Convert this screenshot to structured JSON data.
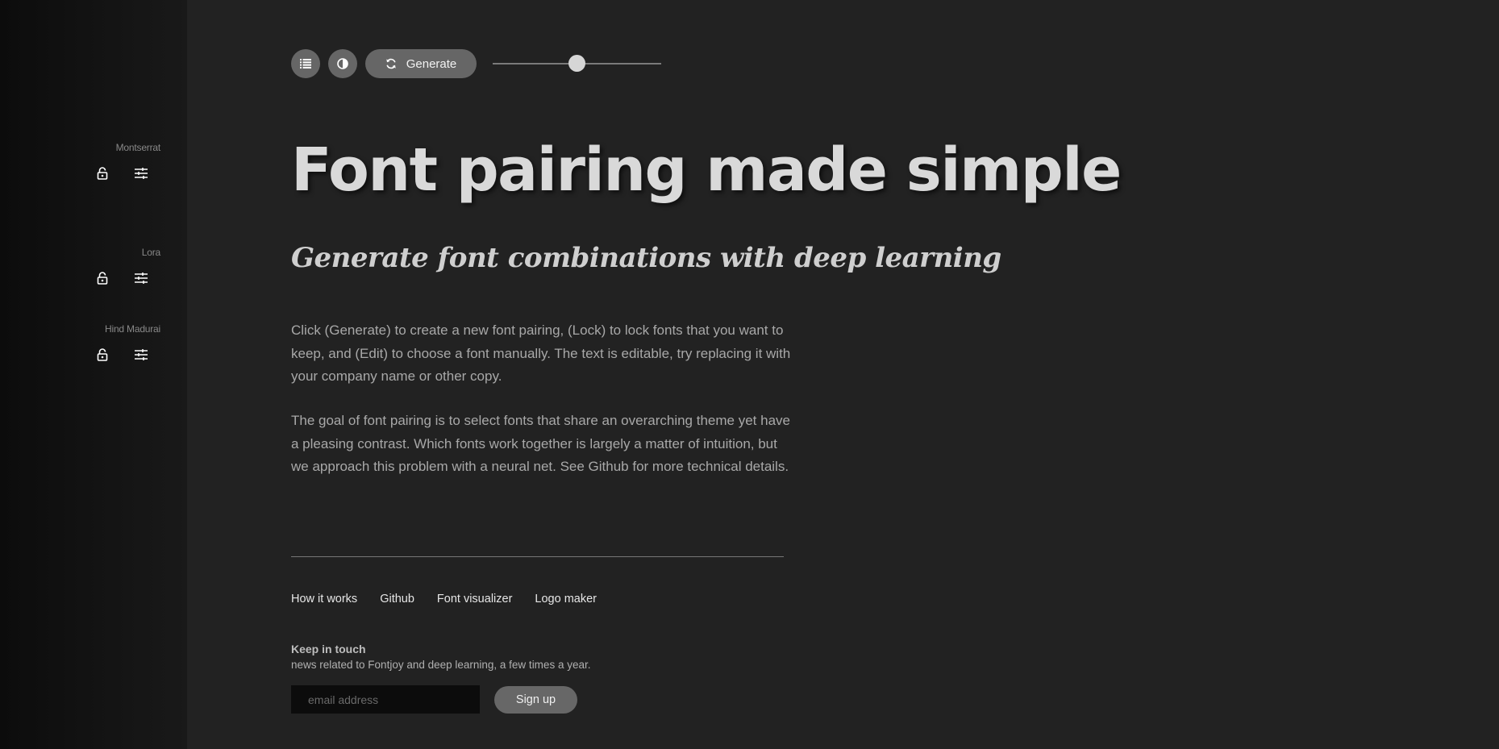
{
  "sidebar": {
    "fonts": [
      {
        "name": "Montserrat"
      },
      {
        "name": "Lora"
      },
      {
        "name": "Hind Madurai"
      }
    ]
  },
  "toolbar": {
    "generate_label": "Generate",
    "weight_slider_fraction": 0.5
  },
  "main": {
    "headline": "Font pairing made simple",
    "subheadline": "Generate font combinations with deep learning",
    "paragraph1": "Click (Generate) to create a new font pairing, (Lock) to lock fonts that you want to keep, and (Edit) to choose a font manually. The text is editable, try replacing it with your company name or other copy.",
    "paragraph2": "The goal of font pairing is to select fonts that share an overarching theme yet have a pleasing contrast. Which fonts work together is largely a matter of intuition, but we approach this problem with a neural net. See Github for more technical details."
  },
  "footer": {
    "links": [
      "How it works",
      "Github",
      "Font visualizer",
      "Logo maker"
    ],
    "keep_title": "Keep in touch",
    "keep_subtitle": "news related to Fontjoy and deep learning, a few times a year.",
    "email_placeholder": "email address",
    "signup_label": "Sign up"
  },
  "colors": {
    "background": "#222222",
    "sidebar": "#111111",
    "button": "#666666"
  }
}
